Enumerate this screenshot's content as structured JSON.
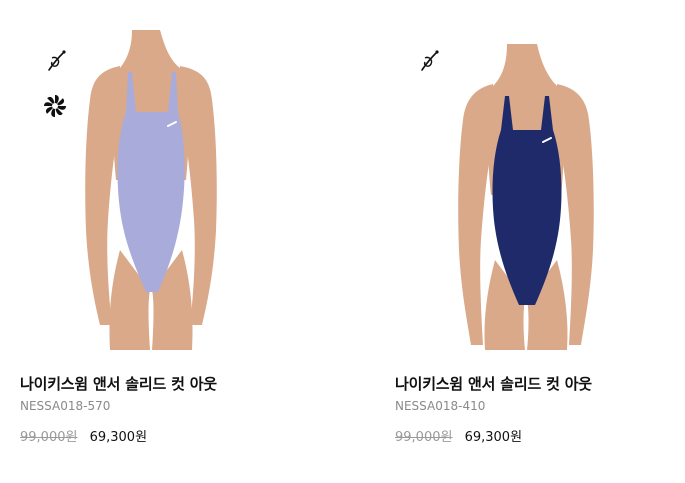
{
  "products": [
    {
      "name": "나이키스윔 앤서 솔리드 컷 아웃",
      "sku": "NESSA018-570",
      "original_price": "99,000원",
      "sale_price": "69,300원",
      "swimsuit_color": "#a9acdb",
      "badges": [
        "sustainable-thread-icon",
        "pinwheel-icon"
      ]
    },
    {
      "name": "나이키스윔 앤서 솔리드 컷 아웃",
      "sku": "NESSA018-410",
      "original_price": "99,000원",
      "sale_price": "69,300원",
      "swimsuit_color": "#1f2a6b",
      "badges": [
        "sustainable-thread-icon"
      ]
    }
  ],
  "colors": {
    "skin": "#d9a98a",
    "text_primary": "#111111",
    "text_secondary": "#8a8a8a"
  }
}
